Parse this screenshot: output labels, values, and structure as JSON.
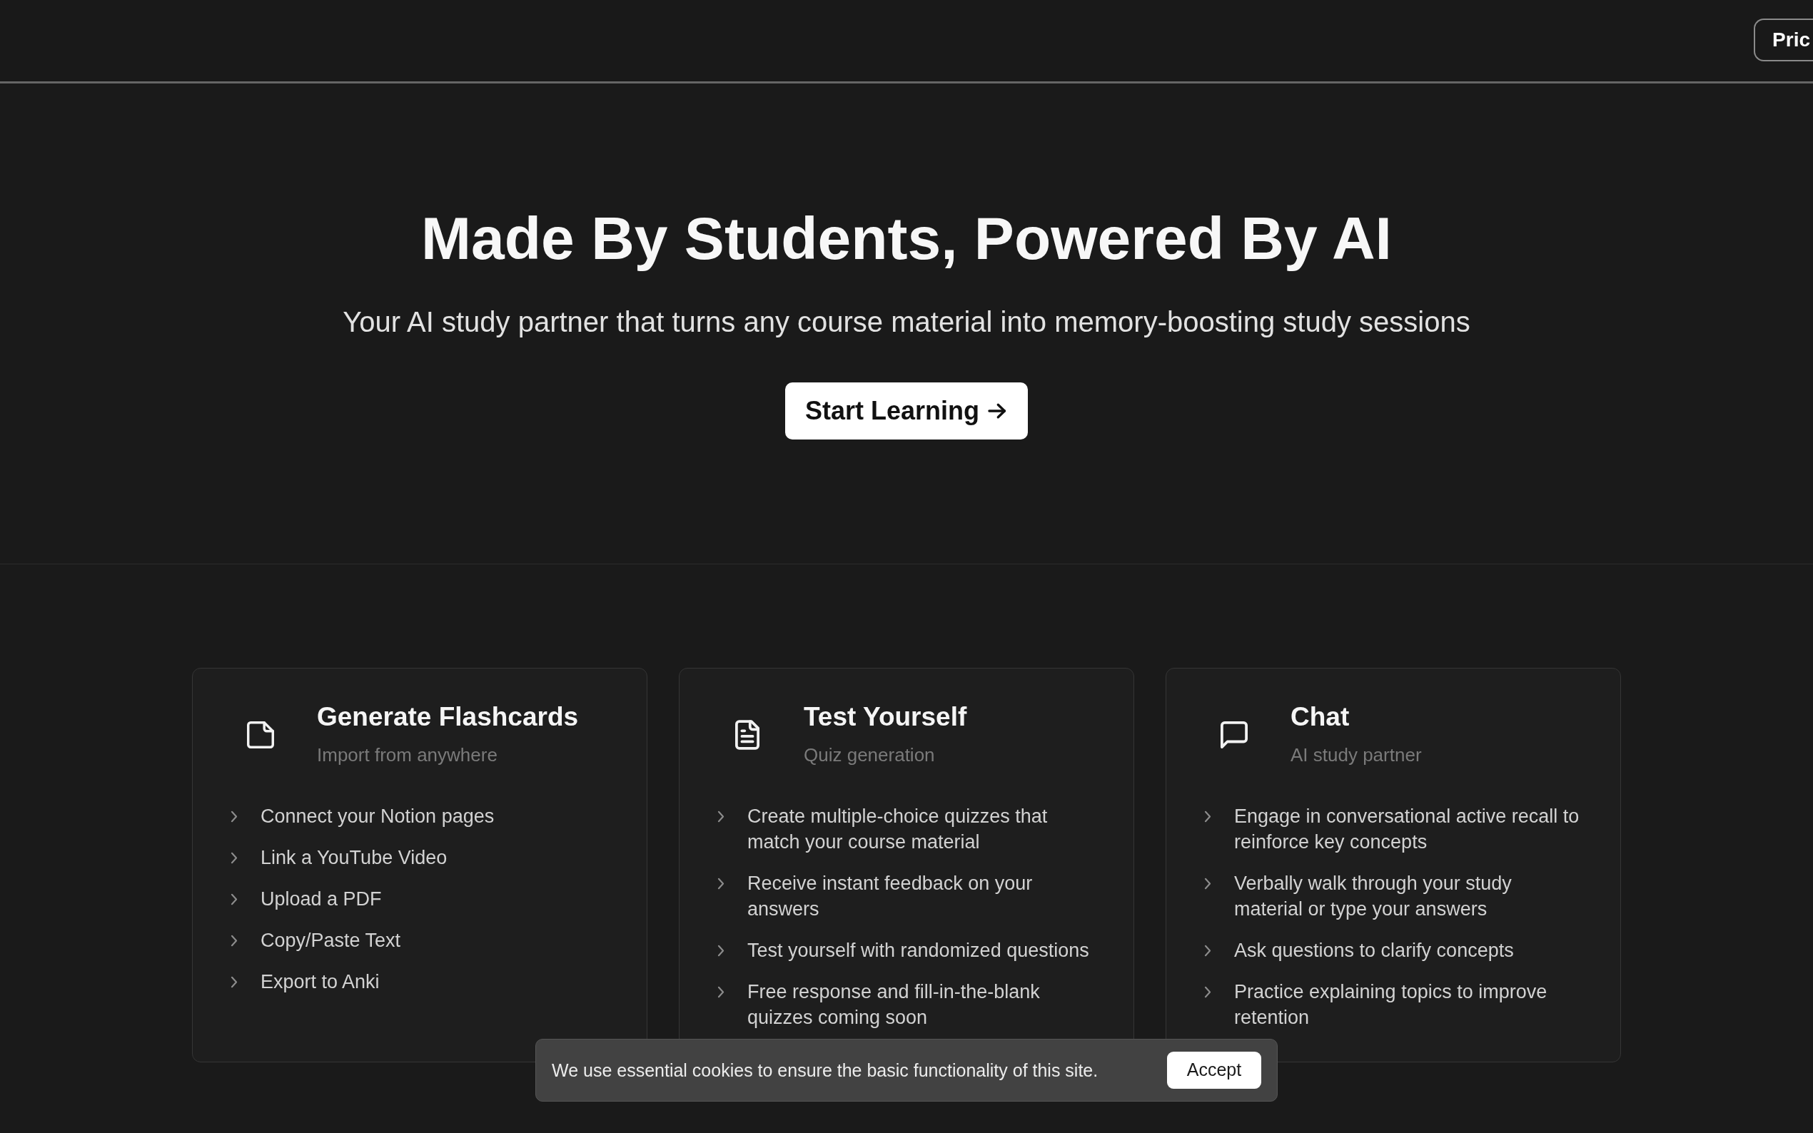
{
  "nav": {
    "pricing_button": "Pric"
  },
  "hero": {
    "title": "Made By Students, Powered By AI",
    "subtitle": "Your AI study partner that turns any course material into memory-boosting study sessions",
    "cta_button": "Start Learning"
  },
  "features": [
    {
      "title": "Generate Flashcards",
      "subtitle": "Import from anywhere",
      "items": [
        "Connect your Notion pages",
        "Link a YouTube Video",
        "Upload a PDF",
        "Copy/Paste Text",
        "Export to Anki"
      ]
    },
    {
      "title": "Test Yourself",
      "subtitle": "Quiz generation",
      "items": [
        "Create multiple-choice quizzes that match your course material",
        "Receive instant feedback on your answers",
        "Test yourself with randomized questions",
        "Free response and fill-in-the-blank quizzes coming soon"
      ]
    },
    {
      "title": "Chat",
      "subtitle": "AI study partner",
      "items": [
        "Engage in conversational active recall to reinforce key concepts",
        "Verbally walk through your study material or type your answers",
        "Ask questions to clarify concepts",
        "Practice explaining topics to improve retention"
      ]
    }
  ],
  "cookie_banner": {
    "message": "We use essential cookies to ensure the basic functionality of this site.",
    "accept_button": "Accept"
  }
}
